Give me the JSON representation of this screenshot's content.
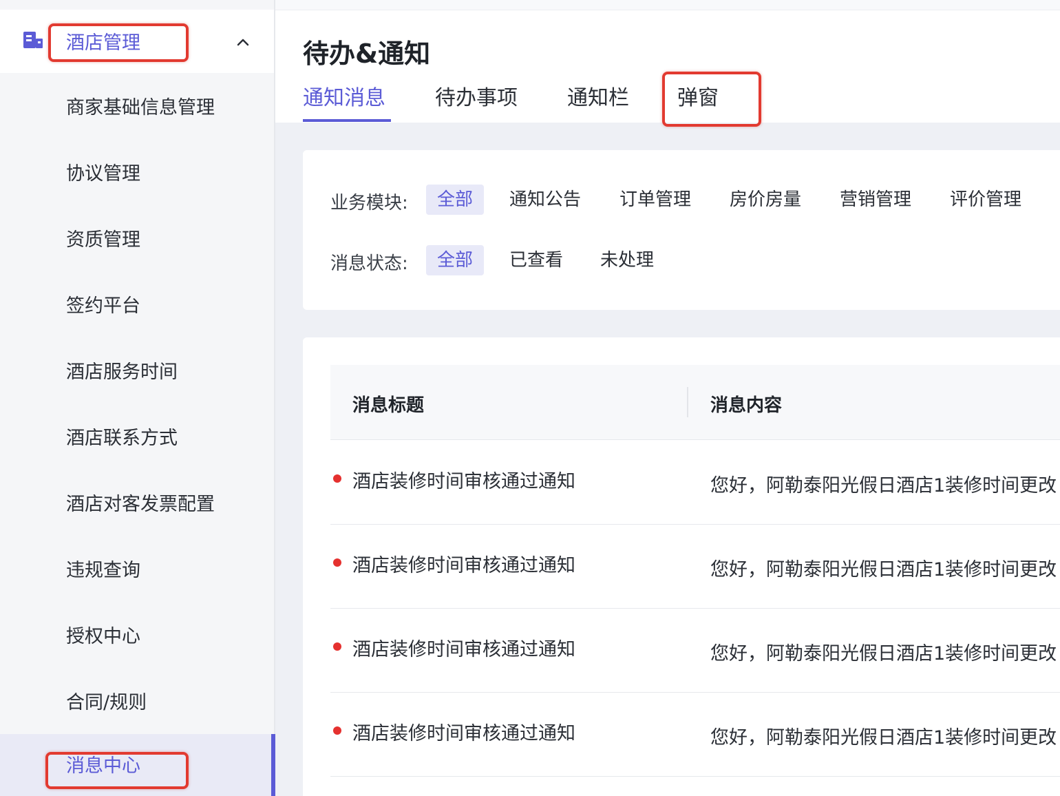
{
  "sidebar": {
    "header_title": "酒店管理",
    "items": [
      {
        "label": "商家基础信息管理"
      },
      {
        "label": "协议管理"
      },
      {
        "label": "资质管理"
      },
      {
        "label": "签约平台"
      },
      {
        "label": "酒店服务时间"
      },
      {
        "label": "酒店联系方式"
      },
      {
        "label": "酒店对客发票配置"
      },
      {
        "label": "违规查询"
      },
      {
        "label": "授权中心"
      },
      {
        "label": "合同/规则"
      },
      {
        "label": "消息中心"
      }
    ],
    "active_item": "消息中心",
    "icons": {
      "header": "building-icon",
      "toggle": "chevron-up-icon"
    }
  },
  "header": {
    "title": "待办&通知",
    "tabs": [
      {
        "label": "通知消息"
      },
      {
        "label": "待办事项"
      },
      {
        "label": "通知栏"
      },
      {
        "label": "弹窗"
      }
    ],
    "active_tab": "通知消息"
  },
  "filters": {
    "business": {
      "label": "业务模块:",
      "options": [
        "全部",
        "通知公告",
        "订单管理",
        "房价房量",
        "营销管理",
        "评价管理"
      ],
      "selected": "全部"
    },
    "status": {
      "label": "消息状态:",
      "options": [
        "全部",
        "已查看",
        "未处理"
      ],
      "selected": "全部"
    }
  },
  "table": {
    "columns": [
      "消息标题",
      "消息内容"
    ],
    "rows": [
      {
        "title": "酒店装修时间审核通过通知",
        "content": "您好，阿勒泰阳光假日酒店1装修时间更改"
      },
      {
        "title": "酒店装修时间审核通过通知",
        "content": "您好，阿勒泰阳光假日酒店1装修时间更改"
      },
      {
        "title": "酒店装修时间审核通过通知",
        "content": "您好，阿勒泰阳光假日酒店1装修时间更改"
      },
      {
        "title": "酒店装修时间审核通过通知",
        "content": "您好，阿勒泰阳光假日酒店1装修时间更改"
      }
    ]
  },
  "colors": {
    "accent": "#5b5bd6",
    "highlight": "#e23a30",
    "unread_dot": "#e5312f"
  }
}
